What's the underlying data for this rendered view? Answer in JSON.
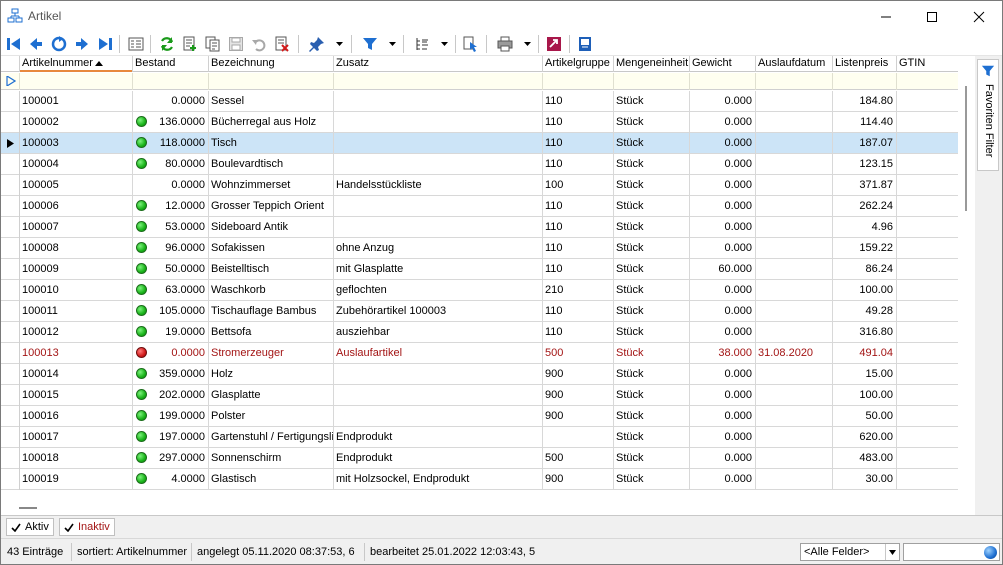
{
  "window": {
    "title": "Artikel"
  },
  "colors": {
    "accent": "#1e6fd1",
    "selected_row": "#cce4f7",
    "inactive_text": "#a31515",
    "sort_marker": "#e8893c"
  },
  "toolbar": {
    "icons": [
      "first-record-icon",
      "previous-record-icon",
      "refresh-page-icon",
      "next-record-icon",
      "last-record-icon",
      "detail-view-icon",
      "refresh-icon",
      "new-record-icon",
      "copy-record-icon",
      "save-icon",
      "undo-icon",
      "delete-record-icon",
      "pin-icon",
      "filter-icon",
      "tree-view-icon",
      "jump-to-icon",
      "print-icon",
      "export-icon",
      "info-icon"
    ]
  },
  "grid": {
    "columns": [
      {
        "label": "Artikelnummer"
      },
      {
        "label": "Bestand"
      },
      {
        "label": "Bezeichnung"
      },
      {
        "label": "Zusatz"
      },
      {
        "label": "Artikelgruppe"
      },
      {
        "label": "Mengeneinheit"
      },
      {
        "label": "Gewicht"
      },
      {
        "label": "Auslaufdatum"
      },
      {
        "label": "Listenpreis"
      },
      {
        "label": "GTIN"
      }
    ],
    "sort_column": "Artikelnummer",
    "sort_direction": "ascending",
    "selected_row": 2,
    "rows": [
      {
        "nr": "100001",
        "status": "",
        "bestand": "0.0000",
        "bez": "Sessel",
        "zusatz": "",
        "gruppe": "110",
        "einheit": "Stück",
        "gewicht": "0.000",
        "auslauf": "",
        "preis": "184.80",
        "gtin": ""
      },
      {
        "nr": "100002",
        "status": "green",
        "bestand": "136.0000",
        "bez": "Bücherregal aus Holz",
        "zusatz": "",
        "gruppe": "110",
        "einheit": "Stück",
        "gewicht": "0.000",
        "auslauf": "",
        "preis": "114.40",
        "gtin": ""
      },
      {
        "nr": "100003",
        "status": "green",
        "bestand": "118.0000",
        "bez": "Tisch",
        "zusatz": "",
        "gruppe": "110",
        "einheit": "Stück",
        "gewicht": "0.000",
        "auslauf": "",
        "preis": "187.07",
        "gtin": ""
      },
      {
        "nr": "100004",
        "status": "green",
        "bestand": "80.0000",
        "bez": "Boulevardtisch",
        "zusatz": "",
        "gruppe": "110",
        "einheit": "Stück",
        "gewicht": "0.000",
        "auslauf": "",
        "preis": "123.15",
        "gtin": ""
      },
      {
        "nr": "100005",
        "status": "",
        "bestand": "0.0000",
        "bez": "Wohnzimmerset",
        "zusatz": "Handelsstückliste",
        "gruppe": "100",
        "einheit": "Stück",
        "gewicht": "0.000",
        "auslauf": "",
        "preis": "371.87",
        "gtin": ""
      },
      {
        "nr": "100006",
        "status": "green",
        "bestand": "12.0000",
        "bez": "Grosser Teppich Orient",
        "zusatz": "",
        "gruppe": "110",
        "einheit": "Stück",
        "gewicht": "0.000",
        "auslauf": "",
        "preis": "262.24",
        "gtin": ""
      },
      {
        "nr": "100007",
        "status": "green",
        "bestand": "53.0000",
        "bez": "Sideboard Antik",
        "zusatz": "",
        "gruppe": "110",
        "einheit": "Stück",
        "gewicht": "0.000",
        "auslauf": "",
        "preis": "4.96",
        "gtin": ""
      },
      {
        "nr": "100008",
        "status": "green",
        "bestand": "96.0000",
        "bez": "Sofakissen",
        "zusatz": "ohne Anzug",
        "gruppe": "110",
        "einheit": "Stück",
        "gewicht": "0.000",
        "auslauf": "",
        "preis": "159.22",
        "gtin": ""
      },
      {
        "nr": "100009",
        "status": "green",
        "bestand": "50.0000",
        "bez": "Beistelltisch",
        "zusatz": "mit Glasplatte",
        "gruppe": "110",
        "einheit": "Stück",
        "gewicht": "60.000",
        "auslauf": "",
        "preis": "86.24",
        "gtin": ""
      },
      {
        "nr": "100010",
        "status": "green",
        "bestand": "63.0000",
        "bez": "Waschkorb",
        "zusatz": "geflochten",
        "gruppe": "210",
        "einheit": "Stück",
        "gewicht": "0.000",
        "auslauf": "",
        "preis": "100.00",
        "gtin": ""
      },
      {
        "nr": "100011",
        "status": "green",
        "bestand": "105.0000",
        "bez": "Tischauflage Bambus",
        "zusatz": "Zubehörartikel 100003",
        "gruppe": "110",
        "einheit": "Stück",
        "gewicht": "0.000",
        "auslauf": "",
        "preis": "49.28",
        "gtin": ""
      },
      {
        "nr": "100012",
        "status": "green",
        "bestand": "19.0000",
        "bez": "Bettsofa",
        "zusatz": "ausziehbar",
        "gruppe": "110",
        "einheit": "Stück",
        "gewicht": "0.000",
        "auslauf": "",
        "preis": "316.80",
        "gtin": ""
      },
      {
        "nr": "100013",
        "status": "red",
        "bestand": "0.0000",
        "bez": "Stromerzeuger",
        "zusatz": "Auslaufartikel",
        "gruppe": "500",
        "einheit": "Stück",
        "gewicht": "38.000",
        "auslauf": "31.08.2020",
        "preis": "491.04",
        "gtin": "",
        "inactive": true
      },
      {
        "nr": "100014",
        "status": "green",
        "bestand": "359.0000",
        "bez": "Holz",
        "zusatz": "",
        "gruppe": "900",
        "einheit": "Stück",
        "gewicht": "0.000",
        "auslauf": "",
        "preis": "15.00",
        "gtin": ""
      },
      {
        "nr": "100015",
        "status": "green",
        "bestand": "202.0000",
        "bez": "Glasplatte",
        "zusatz": "",
        "gruppe": "900",
        "einheit": "Stück",
        "gewicht": "0.000",
        "auslauf": "",
        "preis": "100.00",
        "gtin": ""
      },
      {
        "nr": "100016",
        "status": "green",
        "bestand": "199.0000",
        "bez": "Polster",
        "zusatz": "",
        "gruppe": "900",
        "einheit": "Stück",
        "gewicht": "0.000",
        "auslauf": "",
        "preis": "50.00",
        "gtin": ""
      },
      {
        "nr": "100017",
        "status": "green",
        "bestand": "197.0000",
        "bez": "Gartenstuhl / Fertigungslis",
        "zusatz": "Endprodukt",
        "gruppe": "",
        "einheit": "Stück",
        "gewicht": "0.000",
        "auslauf": "",
        "preis": "620.00",
        "gtin": ""
      },
      {
        "nr": "100018",
        "status": "green",
        "bestand": "297.0000",
        "bez": "Sonnenschirm",
        "zusatz": "Endprodukt",
        "gruppe": "500",
        "einheit": "Stück",
        "gewicht": "0.000",
        "auslauf": "",
        "preis": "483.00",
        "gtin": ""
      },
      {
        "nr": "100019",
        "status": "green",
        "bestand": "4.0000",
        "bez": "Glastisch",
        "zusatz": "mit Holzsockel, Endprodukt",
        "gruppe": "900",
        "einheit": "Stück",
        "gewicht": "0.000",
        "auslauf": "",
        "preis": "30.00",
        "gtin": ""
      }
    ]
  },
  "side_panel": {
    "favorites_label": "Favoriten Filter"
  },
  "tabs": [
    {
      "label": "Aktiv"
    },
    {
      "label": "Inaktiv"
    }
  ],
  "status": {
    "count": "43 Einträge",
    "sorted": "sortiert: Artikelnummer",
    "created": "angelegt 05.11.2020 08:37:53,  6",
    "edited": "bearbeitet 25.01.2022 12:03:43,  5",
    "field_select": "<Alle Felder>",
    "search_value": ""
  }
}
